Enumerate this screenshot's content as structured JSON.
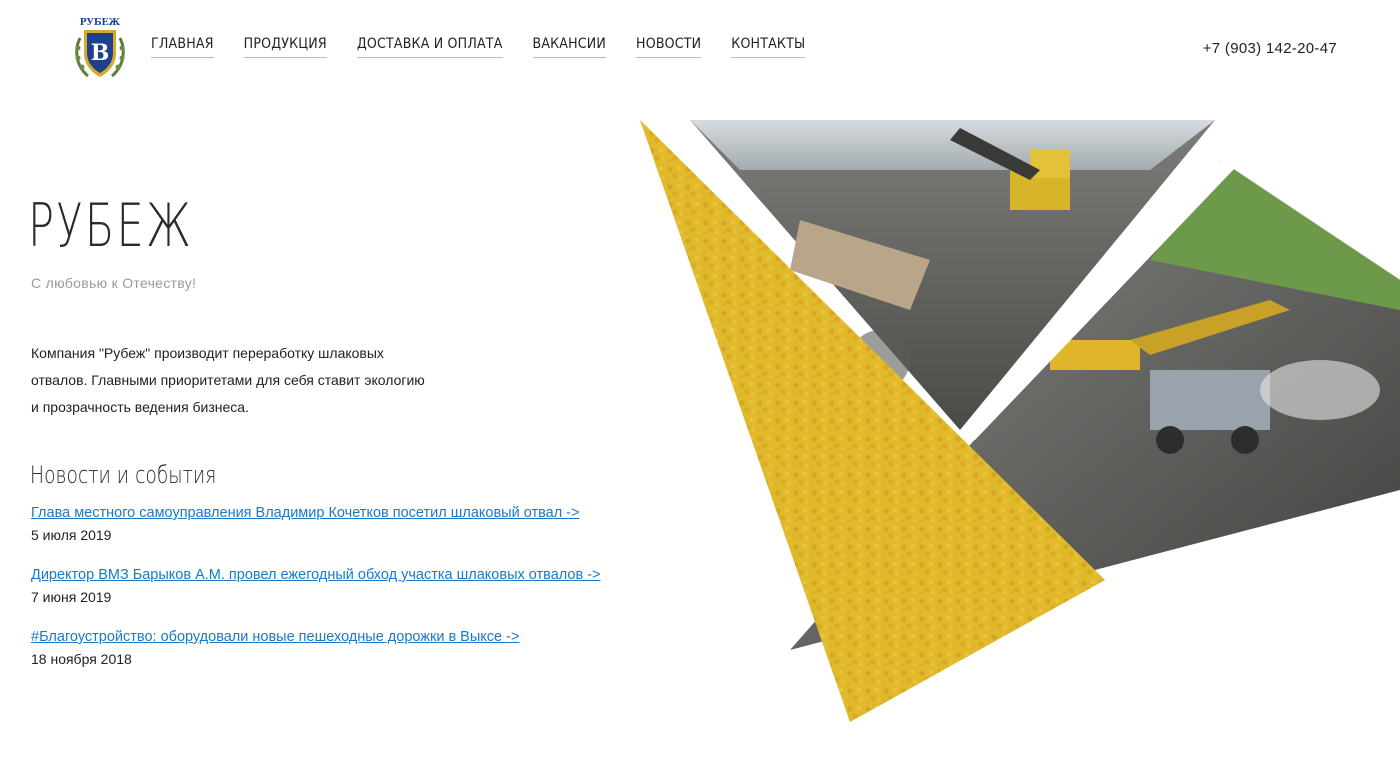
{
  "header": {
    "logo_text": "РУБЕЖ",
    "logo_letter": "В",
    "nav": [
      {
        "label": "ГЛАВНАЯ"
      },
      {
        "label": "ПРОДУКЦИЯ"
      },
      {
        "label": "ДОСТАВКА И ОПЛАТА"
      },
      {
        "label": "ВАКАНСИИ"
      },
      {
        "label": "НОВОСТИ"
      },
      {
        "label": "КОНТАКТЫ"
      }
    ],
    "phone": "+7 (903) 142-20-47"
  },
  "hero": {
    "brand": "РУБЕЖ",
    "slogan": "С любовью к Отечеству!",
    "about": "Компания \"Рубеж\" производит переработку шлаковых отвалов. Главными приоритетами для себя ставит экологию и прозрачность ведения бизнеса."
  },
  "news": {
    "title": "Новости и события",
    "items": [
      {
        "link": "Глава местного самоуправления Владимир Кочетков посетил шлаковый отвал ->",
        "date": "5 июля 2019"
      },
      {
        "link": "Директор ВМЗ Барыков А.М. провел ежегодный обход участка шлаковых отвалов ->",
        "date": "7 июня 2019"
      },
      {
        "link": "#Благоустройство: оборудовали новые пешеходные дорожки в Выксе ->",
        "date": "18 ноября 2018"
      }
    ]
  },
  "colors": {
    "accent_yellow": "#e2b92a",
    "link": "#1a79c9",
    "logo_blue": "#1f3f8f",
    "logo_gold": "#d7a92b"
  }
}
